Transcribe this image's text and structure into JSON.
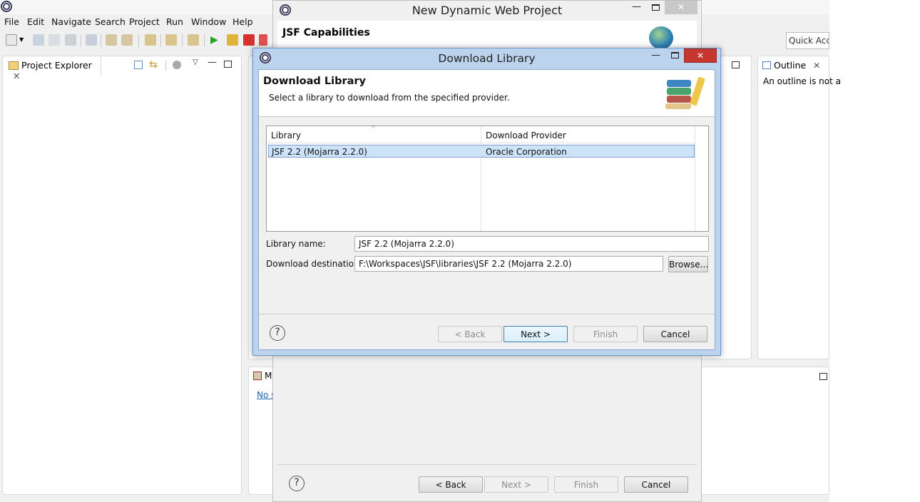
{
  "menubar": {
    "items": [
      "File",
      "Edit",
      "Navigate",
      "Search",
      "Project",
      "Run",
      "Window",
      "Help"
    ]
  },
  "toolbar": {
    "quick_access_placeholder": "Quick Access"
  },
  "views": {
    "project_explorer": {
      "label": "Project Explorer"
    },
    "outline": {
      "label": "Outline",
      "message": "An outline is not a"
    },
    "markers": {
      "label": "M",
      "link": "No s"
    }
  },
  "bg_dialog": {
    "title": "New Dynamic Web Project",
    "header_title": "JSF Capabilities",
    "buttons": {
      "back": "< Back",
      "next": "Next >",
      "finish": "Finish",
      "cancel": "Cancel"
    }
  },
  "dialog": {
    "title": "Download Library",
    "header_title": "Download Library",
    "header_description": "Select a library to download from the specified provider.",
    "table": {
      "columns": [
        "Library",
        "Download Provider"
      ],
      "rows": [
        {
          "library": "JSF 2.2 (Mojarra 2.2.0)",
          "provider": "Oracle Corporation"
        }
      ]
    },
    "library_name_label": "Library name:",
    "library_name_value": "JSF 2.2 (Mojarra 2.2.0)",
    "destination_label": "Download destination:",
    "destination_value": "F:\\Workspaces\\JSF\\libraries\\JSF 2.2 (Mojarra 2.2.0)",
    "browse_label": "Browse...",
    "buttons": {
      "back": "< Back",
      "next": "Next >",
      "finish": "Finish",
      "cancel": "Cancel"
    }
  },
  "colors": {
    "selection": "#cde3f9",
    "dialog_frame": "#bcd3ee",
    "close_button": "#c7372f"
  }
}
